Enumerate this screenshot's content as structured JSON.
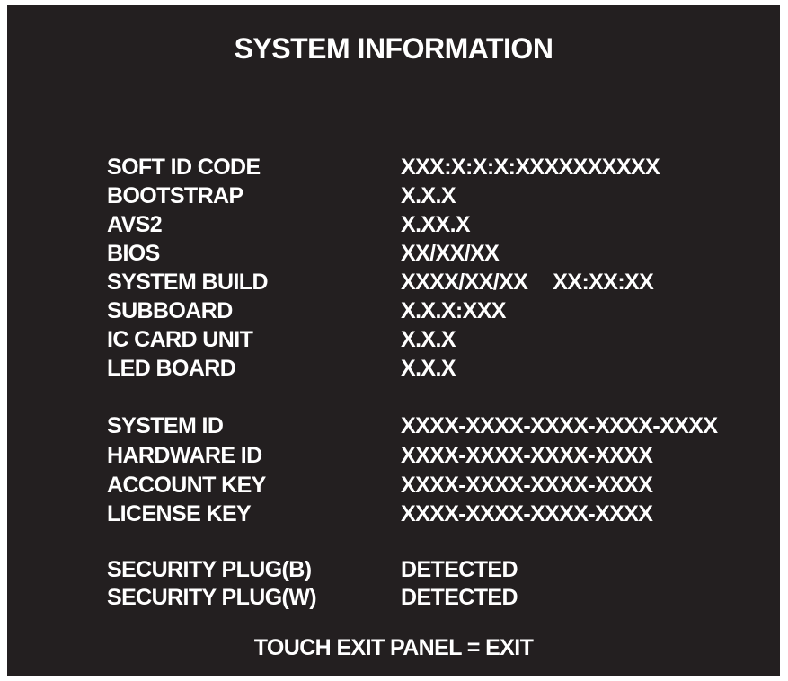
{
  "screen": {
    "title": "SYSTEM INFORMATION",
    "footer": "TOUCH EXIT PANEL = EXIT"
  },
  "versions": [
    {
      "label": "SOFT ID CODE",
      "value": "XXX:X:X:X:XXXXXXXXXX"
    },
    {
      "label": "BOOTSTRAP",
      "value": "X.X.X"
    },
    {
      "label": "AVS2",
      "value": "X.XX.X"
    },
    {
      "label": "BIOS",
      "value": "XX/XX/XX"
    },
    {
      "label": "SYSTEM BUILD",
      "value": "XXXX/XX/XX",
      "value2": "XX:XX:XX"
    },
    {
      "label": "SUBBOARD",
      "value": "X.X.X:XXX"
    },
    {
      "label": "IC CARD UNIT",
      "value": "X.X.X"
    },
    {
      "label": "LED BOARD",
      "value": "X.X.X"
    }
  ],
  "ids": [
    {
      "label": "SYSTEM ID",
      "value": "XXXX-XXXX-XXXX-XXXX-XXXX"
    },
    {
      "label": "HARDWARE ID",
      "value": "XXXX-XXXX-XXXX-XXXX"
    },
    {
      "label": "ACCOUNT KEY",
      "value": "XXXX-XXXX-XXXX-XXXX"
    },
    {
      "label": "LICENSE KEY",
      "value": "XXXX-XXXX-XXXX-XXXX"
    }
  ],
  "security": [
    {
      "label": "SECURITY PLUG(B)",
      "value": "DETECTED"
    },
    {
      "label": "SECURITY PLUG(W)",
      "value": "DETECTED"
    }
  ]
}
